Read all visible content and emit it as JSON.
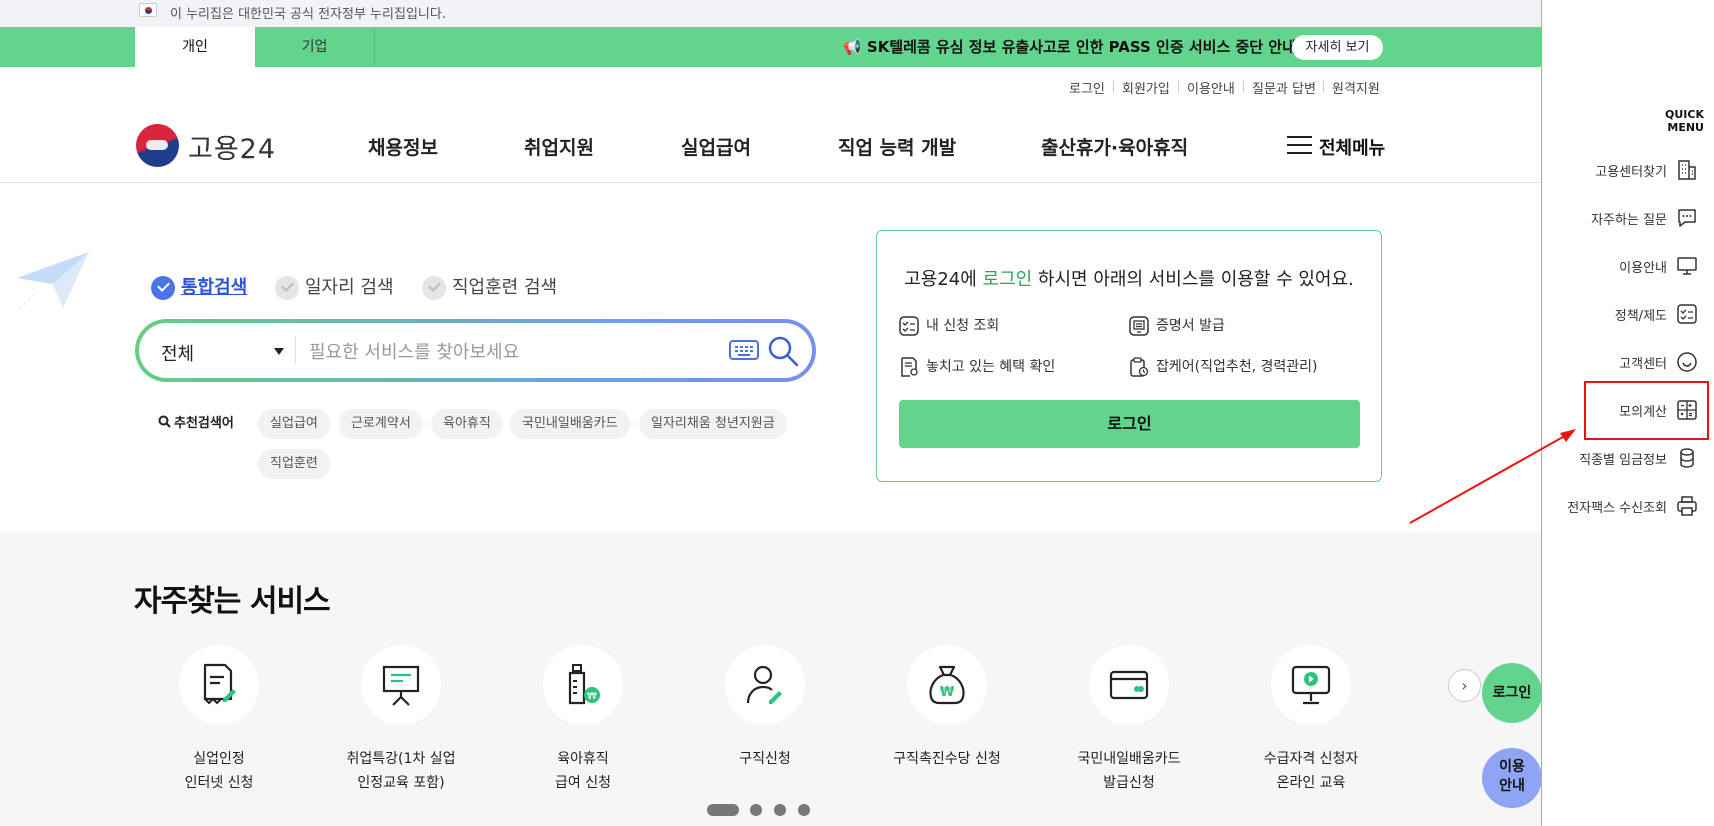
{
  "gov_banner": {
    "text": "이 누리집은 대한민국 공식 전자정부 누리집입니다."
  },
  "topbar": {
    "tabs": [
      {
        "label": "개인"
      },
      {
        "label": "기업"
      }
    ],
    "notice": "📢 SK텔레콤 유심 정보 유출사고로 인한 PASS 인증 서비스 중단 안내",
    "notice_button": "자세히 보기"
  },
  "util_links": [
    "로그인",
    "회원가입",
    "이용안내",
    "질문과 답변",
    "원격지원"
  ],
  "logo": {
    "text": "고용24"
  },
  "gnb": [
    "채용정보",
    "취업지원",
    "실업급여",
    "직업 능력 개발",
    "출산휴가·육아휴직"
  ],
  "all_menu": "전체메뉴",
  "search": {
    "types": [
      "통합검색",
      "일자리 검색",
      "직업훈련 검색"
    ],
    "selected_type": "통합검색",
    "category": "전체",
    "placeholder": "필요한 서비스를 찾아보세요",
    "recommended_label": "추천검색어",
    "recommended": [
      "실업급여",
      "근로계약서",
      "육아휴직",
      "국민내일배움카드",
      "일자리채움 청년지원금",
      "직업훈련"
    ]
  },
  "login_card": {
    "title_pre": "고용24에 ",
    "title_link": "로그인",
    "title_post": " 하시면 아래의 서비스를 이용할 수 있어요.",
    "items": [
      "내 신청 조회",
      "증명서 발급",
      "놓치고 있는 혜택 확인",
      "잡케어(직업추천, 경력관리)"
    ],
    "button": "로그인"
  },
  "services": {
    "title": "자주찾는 서비스",
    "items": [
      {
        "line1": "실업인정",
        "line2": "인터넷 신청",
        "icon": "document-pen-icon"
      },
      {
        "line1": "취업특강(1차 실업",
        "line2": "인정교육 포함)",
        "icon": "presentation-board-icon"
      },
      {
        "line1": "육아휴직",
        "line2": "급여 신청",
        "icon": "baby-bottle-icon"
      },
      {
        "line1": "구직신청",
        "line2": "",
        "icon": "person-pen-icon"
      },
      {
        "line1": "구직촉진수당 신청",
        "line2": "",
        "icon": "money-bag-icon"
      },
      {
        "line1": "국민내일배움카드",
        "line2": "발급신청",
        "icon": "card-icon"
      },
      {
        "line1": "수급자격 신청자",
        "line2": "온라인 교육",
        "icon": "monitor-play-icon"
      }
    ],
    "pager_count": 4,
    "active_page": 1
  },
  "floating": {
    "login": "로그인",
    "guide_line1": "이용",
    "guide_line2": "안내"
  },
  "quick_menu": {
    "title_line1": "QUICK",
    "title_line2": "MENU",
    "items": [
      {
        "label": "고용센터찾기",
        "icon": "building-icon"
      },
      {
        "label": "자주하는 질문",
        "icon": "chat-bubble-icon"
      },
      {
        "label": "이용안내",
        "icon": "monitor-icon"
      },
      {
        "label": "정책/제도",
        "icon": "checklist-icon"
      },
      {
        "label": "고객센터",
        "icon": "smile-icon"
      },
      {
        "label": "모의계산",
        "icon": "calculator-icon"
      },
      {
        "label": "직종별 임금정보",
        "icon": "coins-icon"
      },
      {
        "label": "전자팩스 수신조회",
        "icon": "printer-icon"
      }
    ]
  },
  "colors": {
    "brand_green": "#63d48e",
    "link_blue": "#2a56d8",
    "annotation_red": "#e11111"
  }
}
